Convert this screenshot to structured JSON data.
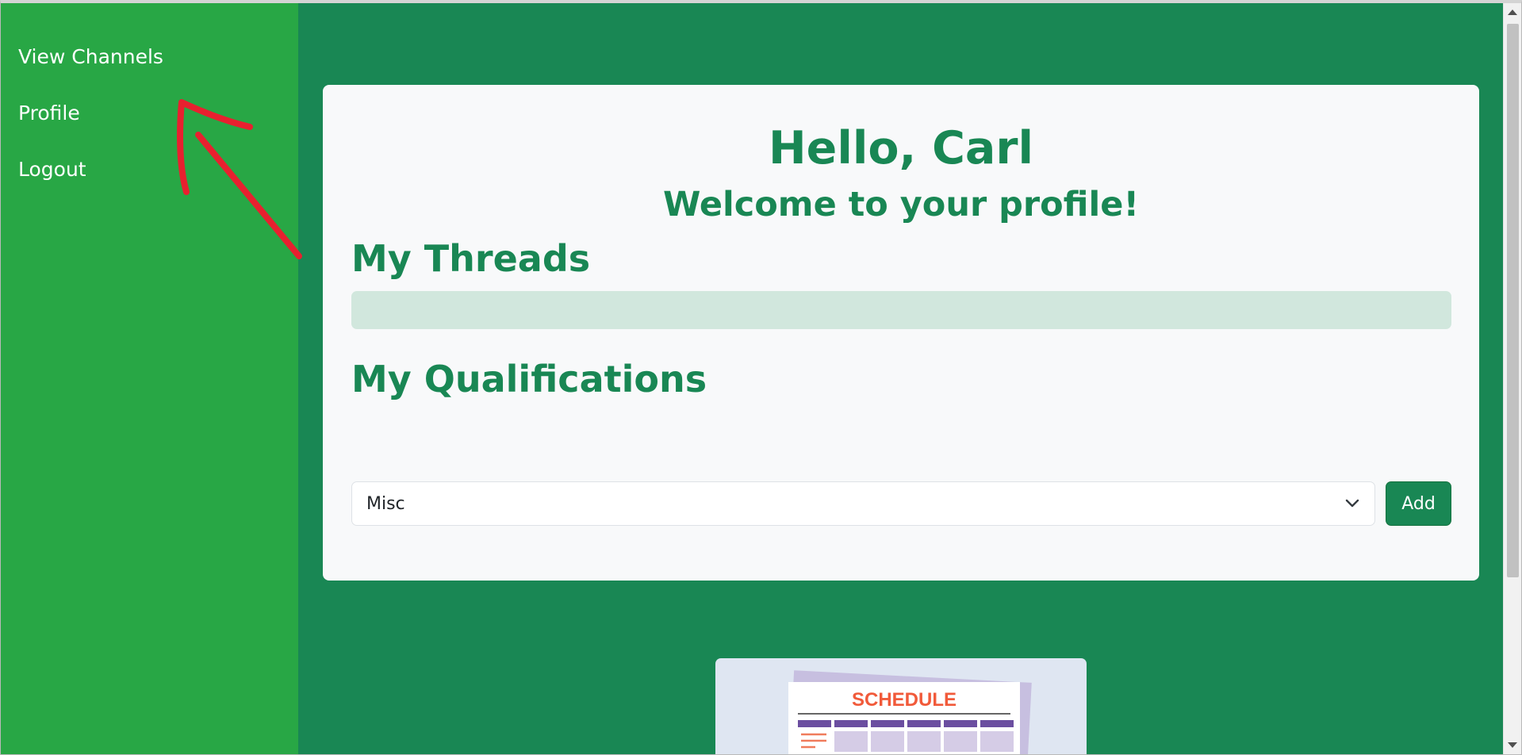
{
  "sidebar": {
    "items": [
      {
        "label": "View Channels"
      },
      {
        "label": "Profile"
      },
      {
        "label": "Logout"
      }
    ]
  },
  "profile": {
    "greeting": "Hello, Carl",
    "welcome": "Welcome to your profile!",
    "threads_title": "My Threads",
    "qualifications_title": "My Qualifications",
    "qualification_select": {
      "selected": "Misc"
    },
    "add_label": "Add"
  },
  "illustration": {
    "title": "SCHEDULE"
  },
  "colors": {
    "sidebar": "#28a745",
    "main_bg": "#198754",
    "accent": "#198754",
    "annotation": "#e8202f"
  }
}
